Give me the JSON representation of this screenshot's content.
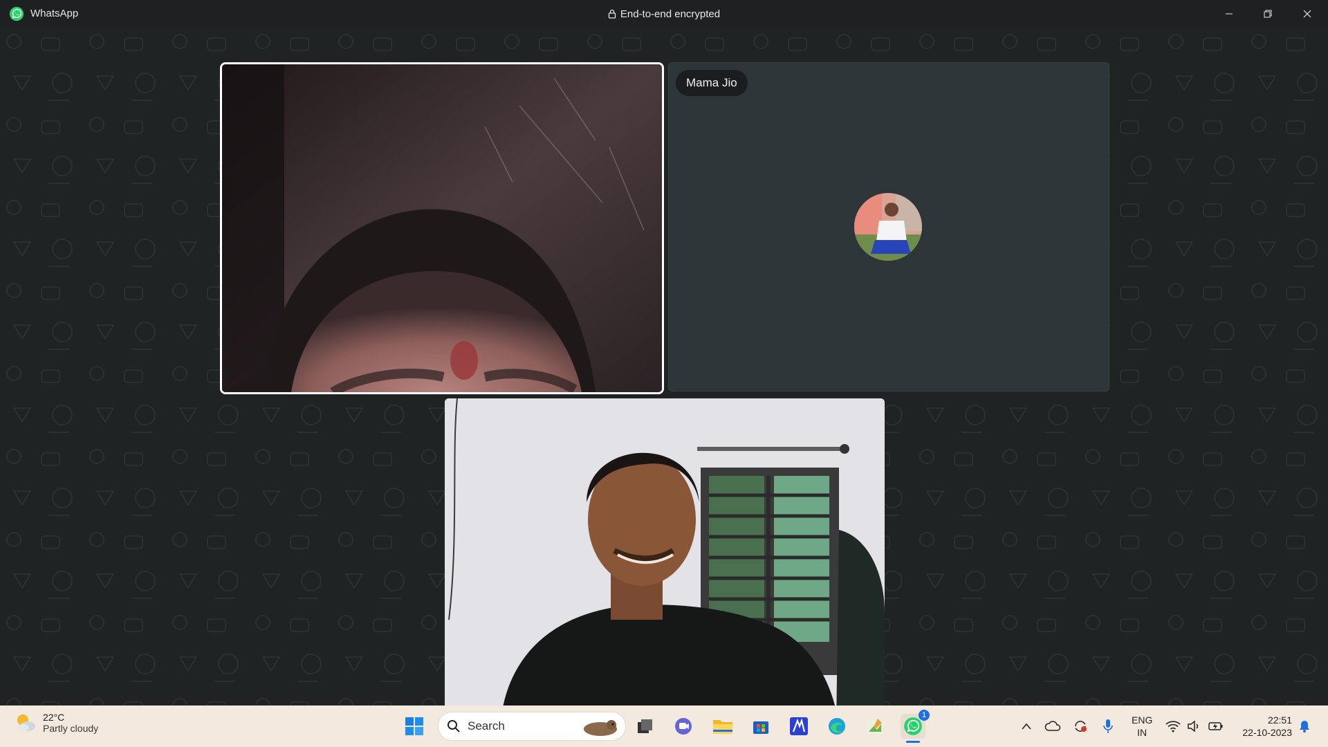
{
  "titlebar": {
    "app_title": "WhatsApp",
    "encryption_label": "End-to-end encrypted",
    "minimize": "minimize-icon",
    "restore": "restore-icon",
    "close": "close-icon"
  },
  "call": {
    "participants": [
      {
        "role": "video",
        "name": ""
      },
      {
        "role": "audio-only",
        "name": "Mama Jio"
      },
      {
        "role": "self-video",
        "name": ""
      }
    ]
  },
  "taskbar": {
    "weather_temp": "22°C",
    "weather_condition": "Partly cloudy",
    "search_placeholder": "Search",
    "whatsapp_badge": "1",
    "lang_line1": "ENG",
    "lang_line2": "IN",
    "time": "22:51",
    "date": "22-10-2023"
  },
  "colors": {
    "whatsapp_green": "#25d366",
    "stage_bg": "#202324",
    "taskbar_bg": "#f3e9de"
  }
}
